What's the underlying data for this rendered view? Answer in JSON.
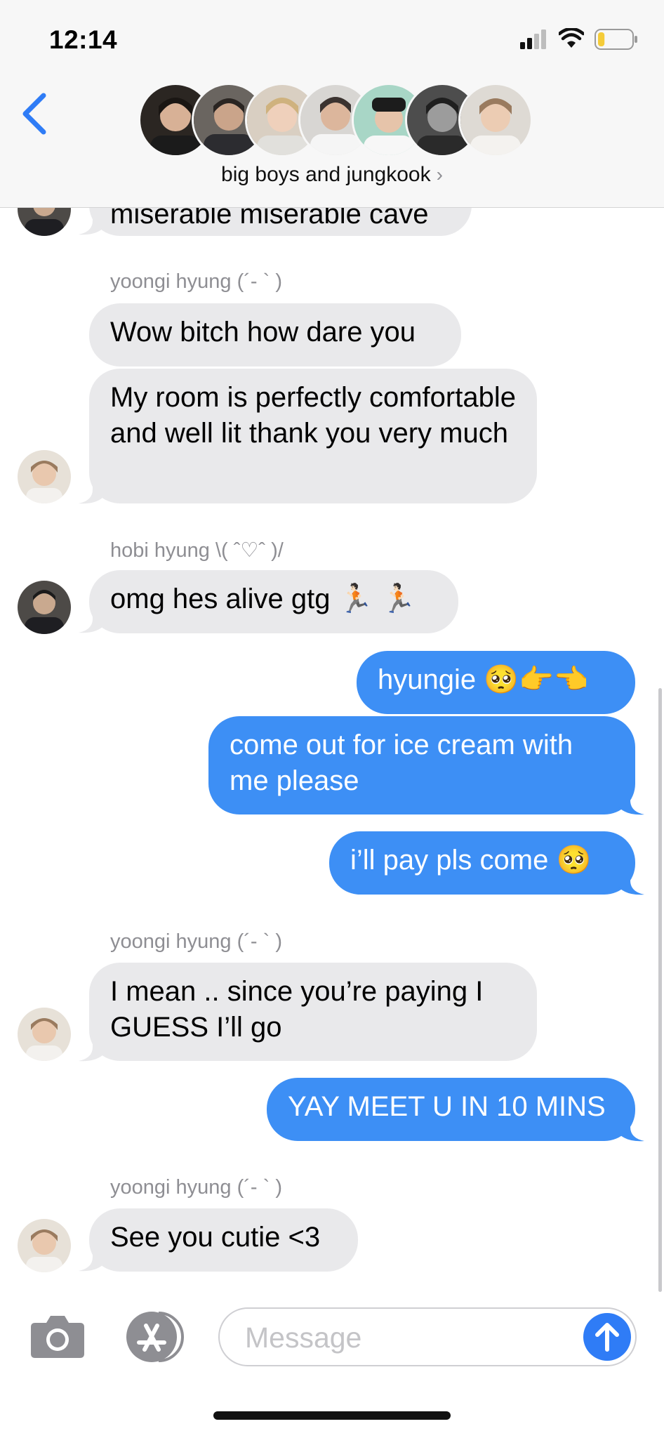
{
  "status_bar": {
    "time": "12:14",
    "battery_level": 0.2
  },
  "header": {
    "group_name": "big boys and jungkook",
    "chevron": "›",
    "avatar_count": 7
  },
  "messages": [
    {
      "kind": "in",
      "text": "miserable miserable cave"
    },
    {
      "kind": "sender",
      "text": "yoongi hyung (´- ` )"
    },
    {
      "kind": "in",
      "text": "Wow bitch how dare you"
    },
    {
      "kind": "in",
      "text": "My room is perfectly comfortable and well lit thank you very much"
    },
    {
      "kind": "sender",
      "text": "hobi hyung \\( ˆ♡ˆ )/"
    },
    {
      "kind": "in",
      "text": "omg hes alive gtg 🏃🏻 🏃🏻"
    },
    {
      "kind": "out",
      "text": "hyungie 🥺👉👈"
    },
    {
      "kind": "out",
      "text": "come out for ice cream with me please"
    },
    {
      "kind": "out",
      "text": "i’ll pay pls come 🥺"
    },
    {
      "kind": "sender",
      "text": "yoongi hyung (´- ` )"
    },
    {
      "kind": "in",
      "text": "I mean .. since you’re paying I GUESS I’ll go"
    },
    {
      "kind": "out",
      "text": "YAY MEET U IN 10 MINS"
    },
    {
      "kind": "sender",
      "text": "yoongi hyung (´- ` )"
    },
    {
      "kind": "in",
      "text": "See you cutie <3"
    }
  ],
  "input": {
    "placeholder": "Message"
  },
  "icons": {
    "back": "chevron-left-icon",
    "camera": "camera-icon",
    "apps": "app-store-icon",
    "send": "arrow-up-icon"
  },
  "colors": {
    "accent": "#3d8ff5",
    "incoming_bubble": "#e9e9eb",
    "ios_blue": "#2f7cf6"
  }
}
